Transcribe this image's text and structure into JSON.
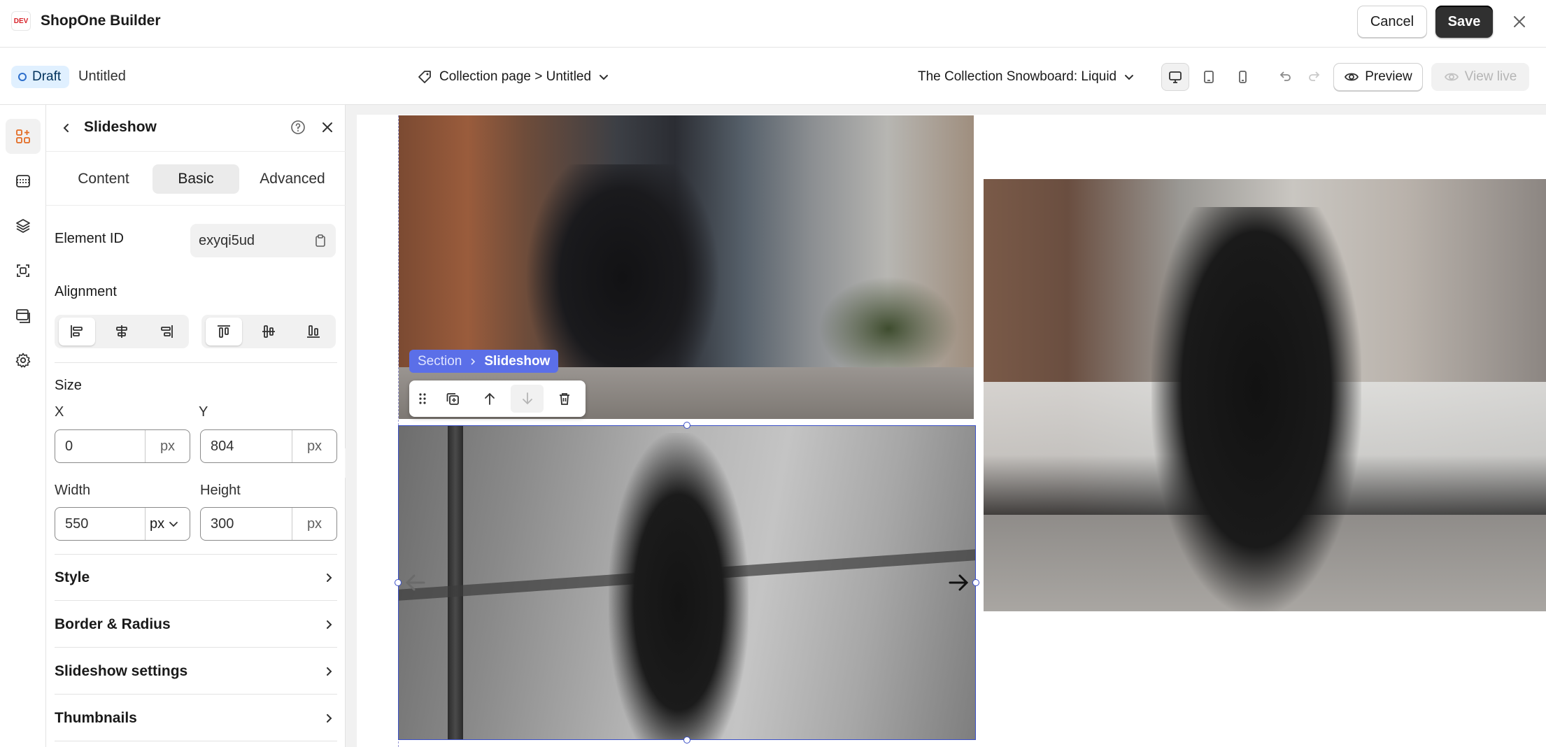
{
  "app": {
    "logo_text": "DEV",
    "title": "ShopOne Builder",
    "cancel_label": "Cancel",
    "save_label": "Save"
  },
  "subbar": {
    "status": "Draft",
    "doc_title": "Untitled",
    "page_selector": "Collection page > Untitled",
    "template_selector": "The Collection Snowboard: Liquid",
    "preview_label": "Preview",
    "view_live_label": "View live"
  },
  "panel": {
    "title": "Slideshow",
    "tabs": [
      {
        "label": "Content",
        "active": false
      },
      {
        "label": "Basic",
        "active": true
      },
      {
        "label": "Advanced",
        "active": false
      }
    ],
    "element_id": {
      "label": "Element ID",
      "value": "exyqi5ud"
    },
    "alignment": {
      "label": "Alignment"
    },
    "size": {
      "label": "Size",
      "x": {
        "label": "X",
        "value": "0",
        "unit": "px"
      },
      "y": {
        "label": "Y",
        "value": "804",
        "unit": "px"
      },
      "width": {
        "label": "Width",
        "value": "550",
        "unit": "px"
      },
      "height": {
        "label": "Height",
        "value": "300",
        "unit": "px"
      }
    },
    "sections": [
      {
        "label": "Style"
      },
      {
        "label": "Border & Radius"
      },
      {
        "label": "Slideshow settings"
      },
      {
        "label": "Thumbnails"
      }
    ]
  },
  "canvas": {
    "breadcrumb": {
      "parent": "Section",
      "current": "Slideshow"
    }
  },
  "colors": {
    "accent": "#5b6fe8",
    "selection": "#3a4fc7",
    "save": "#303030",
    "draft_badge": "#e0f0ff"
  }
}
